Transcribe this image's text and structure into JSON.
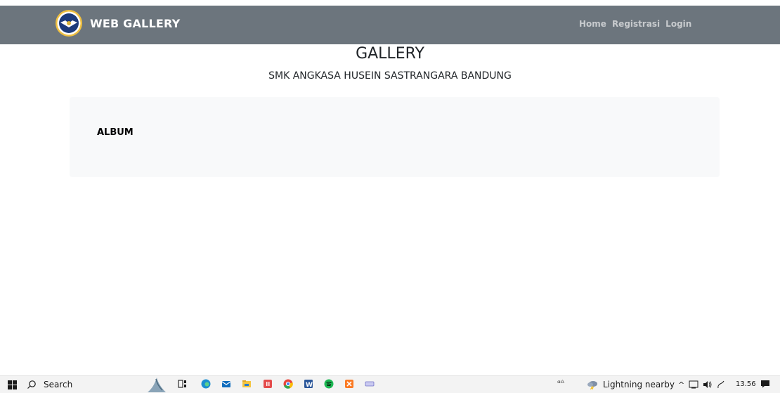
{
  "navbar": {
    "brand": "WEB GALLERY",
    "links": [
      "Home",
      "Registrasi",
      "Login"
    ]
  },
  "header": {
    "title": "GALLERY",
    "subtitle": "SMK ANGKASA HUSEIN SASTRANGARA BANDUNG"
  },
  "album": {
    "title": "ALBUM"
  },
  "taskbar": {
    "search_label": "Search",
    "weather": "Lightning nearby",
    "time": "13.56",
    "icons": [
      "windows-start-icon",
      "search-icon",
      "task-view-icon",
      "edge-icon",
      "mail-icon",
      "file-explorer-icon",
      "app-icon",
      "chrome-icon",
      "word-icon",
      "spotify-icon",
      "xampp-icon",
      "keyboard-icon",
      "people-icon",
      "weather-icon",
      "chevron-up-icon",
      "network-icon",
      "volume-icon",
      "pen-icon",
      "notification-icon"
    ]
  },
  "colors": {
    "navbar_bg": "#6c757d",
    "card_bg": "#f8f9fa",
    "taskbar_bg": "#f3f3f3"
  }
}
